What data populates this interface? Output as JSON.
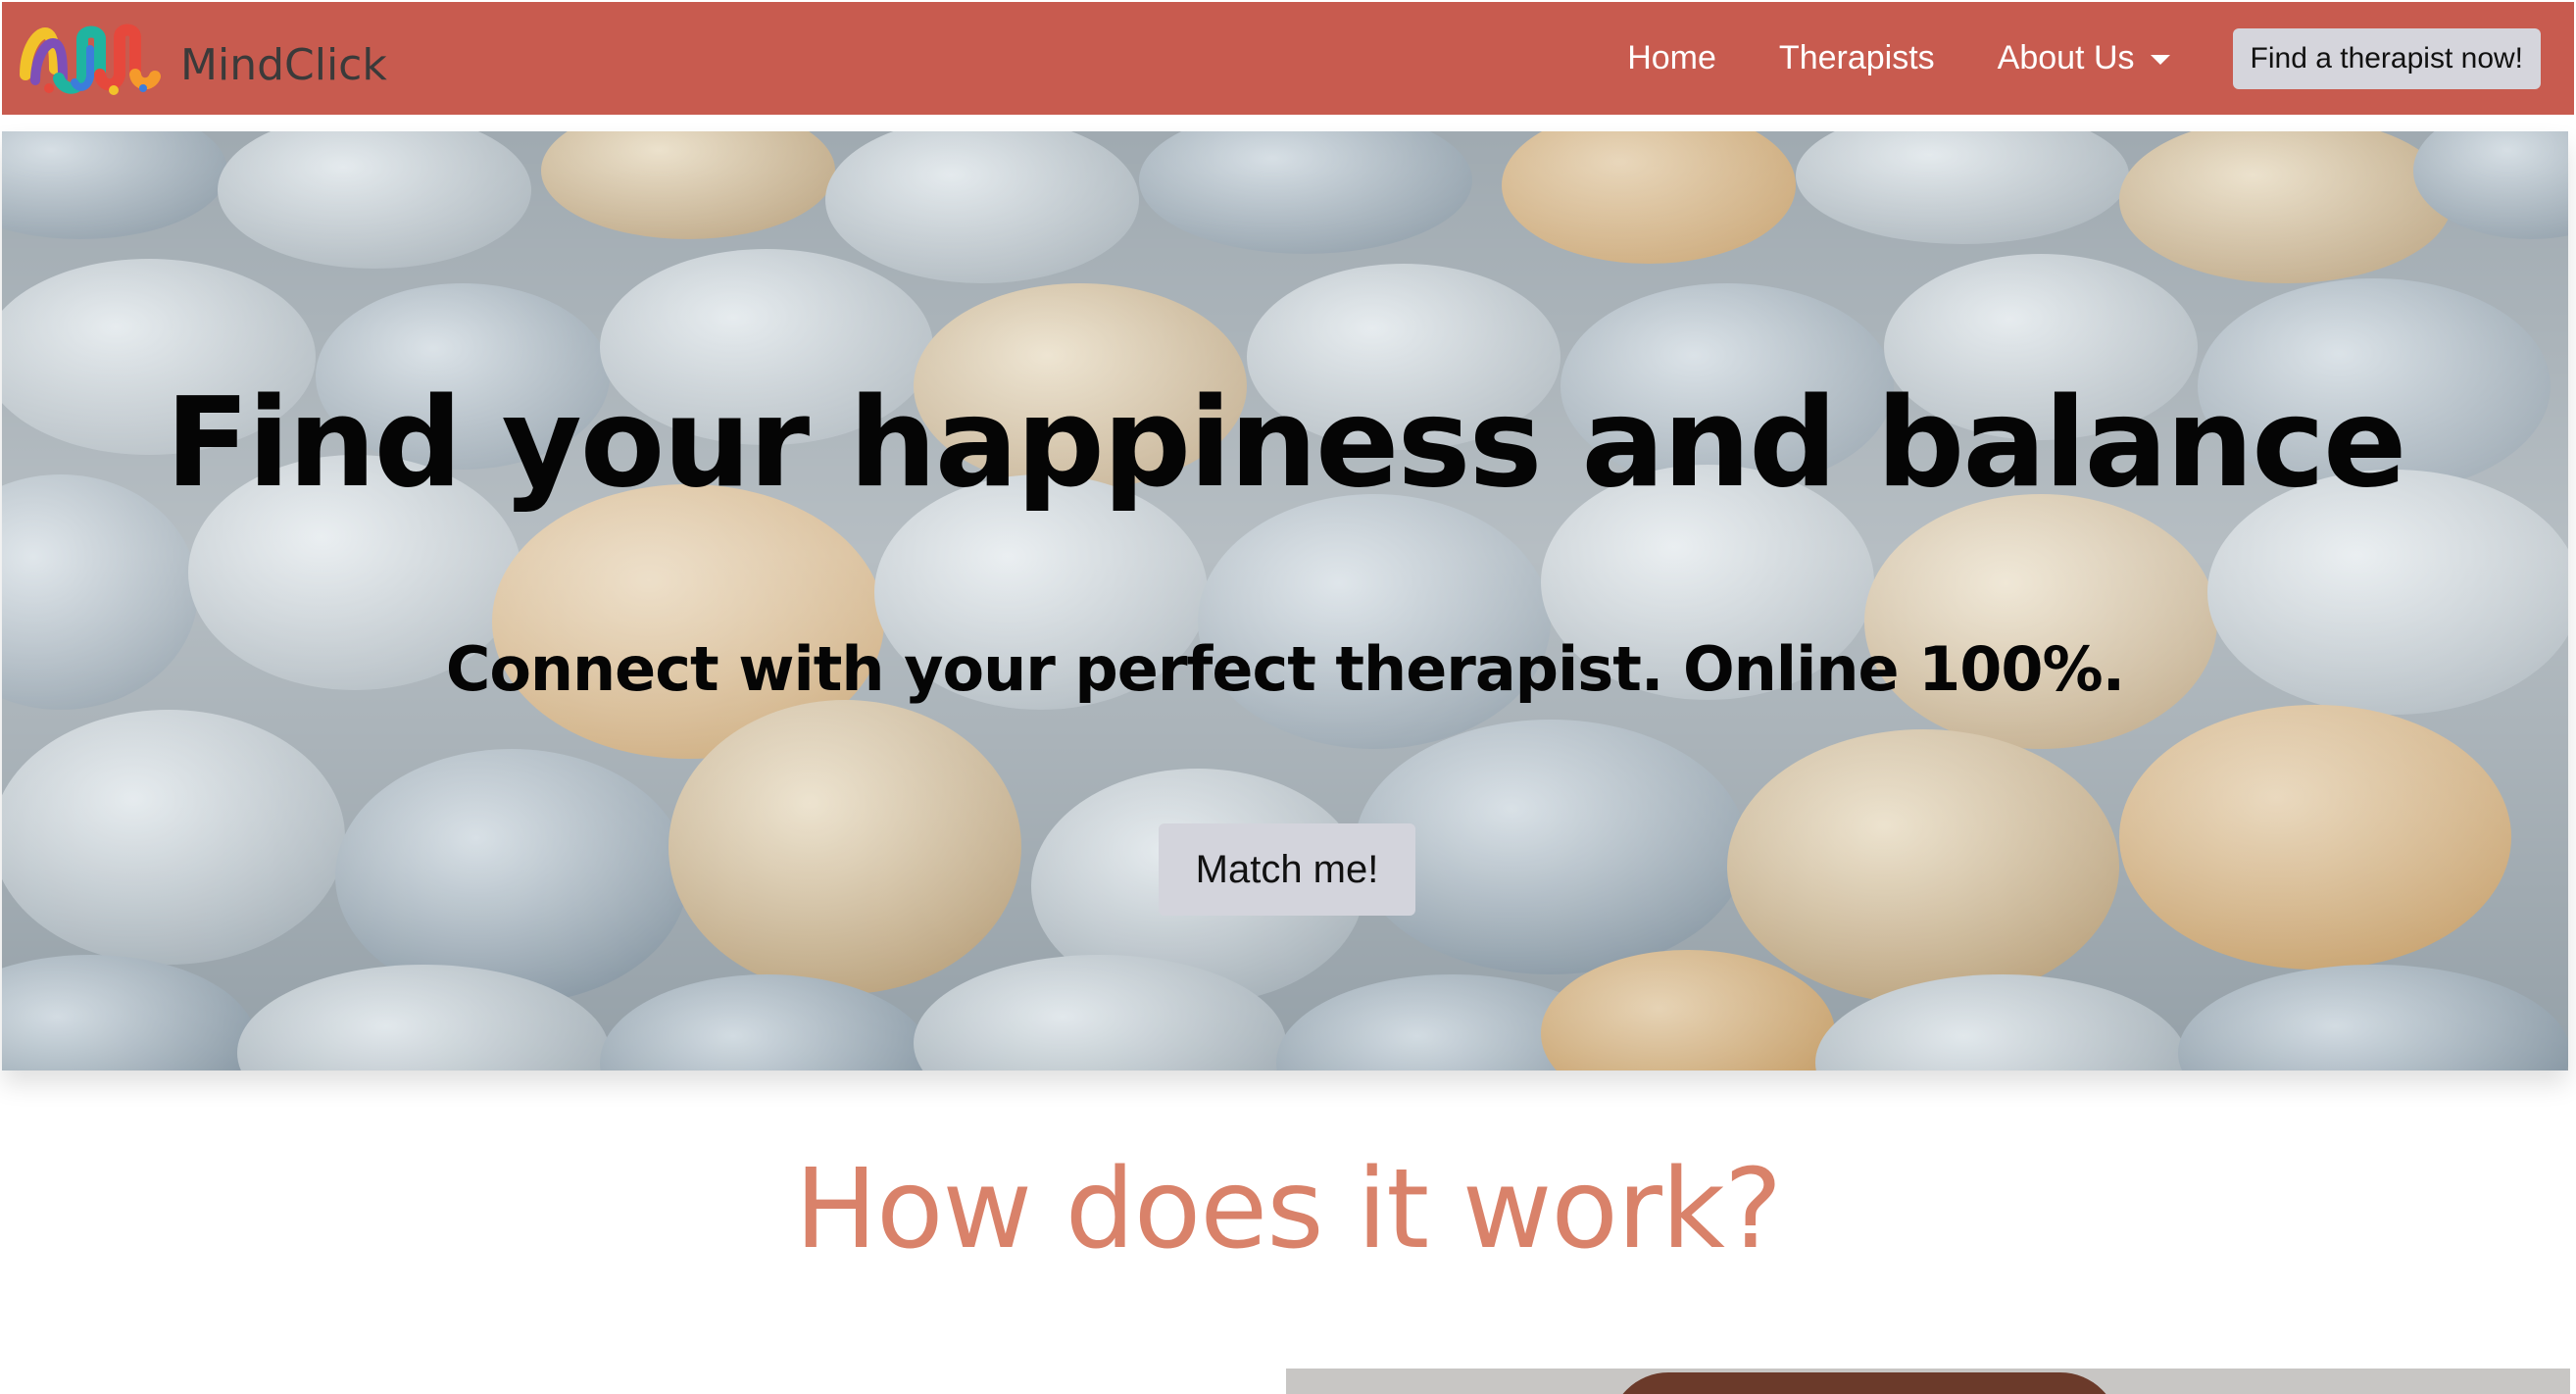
{
  "brand": {
    "name": "MindClick",
    "colors": [
      "#f2c32a",
      "#e6483c",
      "#1fb4a0",
      "#7e4fb8",
      "#f59a2b",
      "#3c7ddb"
    ]
  },
  "navbar": {
    "background": "#c85b4f",
    "links": [
      {
        "label": "Home"
      },
      {
        "label": "Therapists"
      },
      {
        "label": "About Us",
        "has_dropdown": true
      }
    ],
    "cta_label": "Find a therapist now!"
  },
  "hero": {
    "title": "Find your happiness and balance",
    "subtitle": "Connect with your perfect therapist. Online 100%.",
    "button_label": "Match me!",
    "background": "photo of smooth stones under clear water"
  },
  "how_it_works": {
    "title": "How does it work?",
    "title_color": "#d9826a"
  }
}
